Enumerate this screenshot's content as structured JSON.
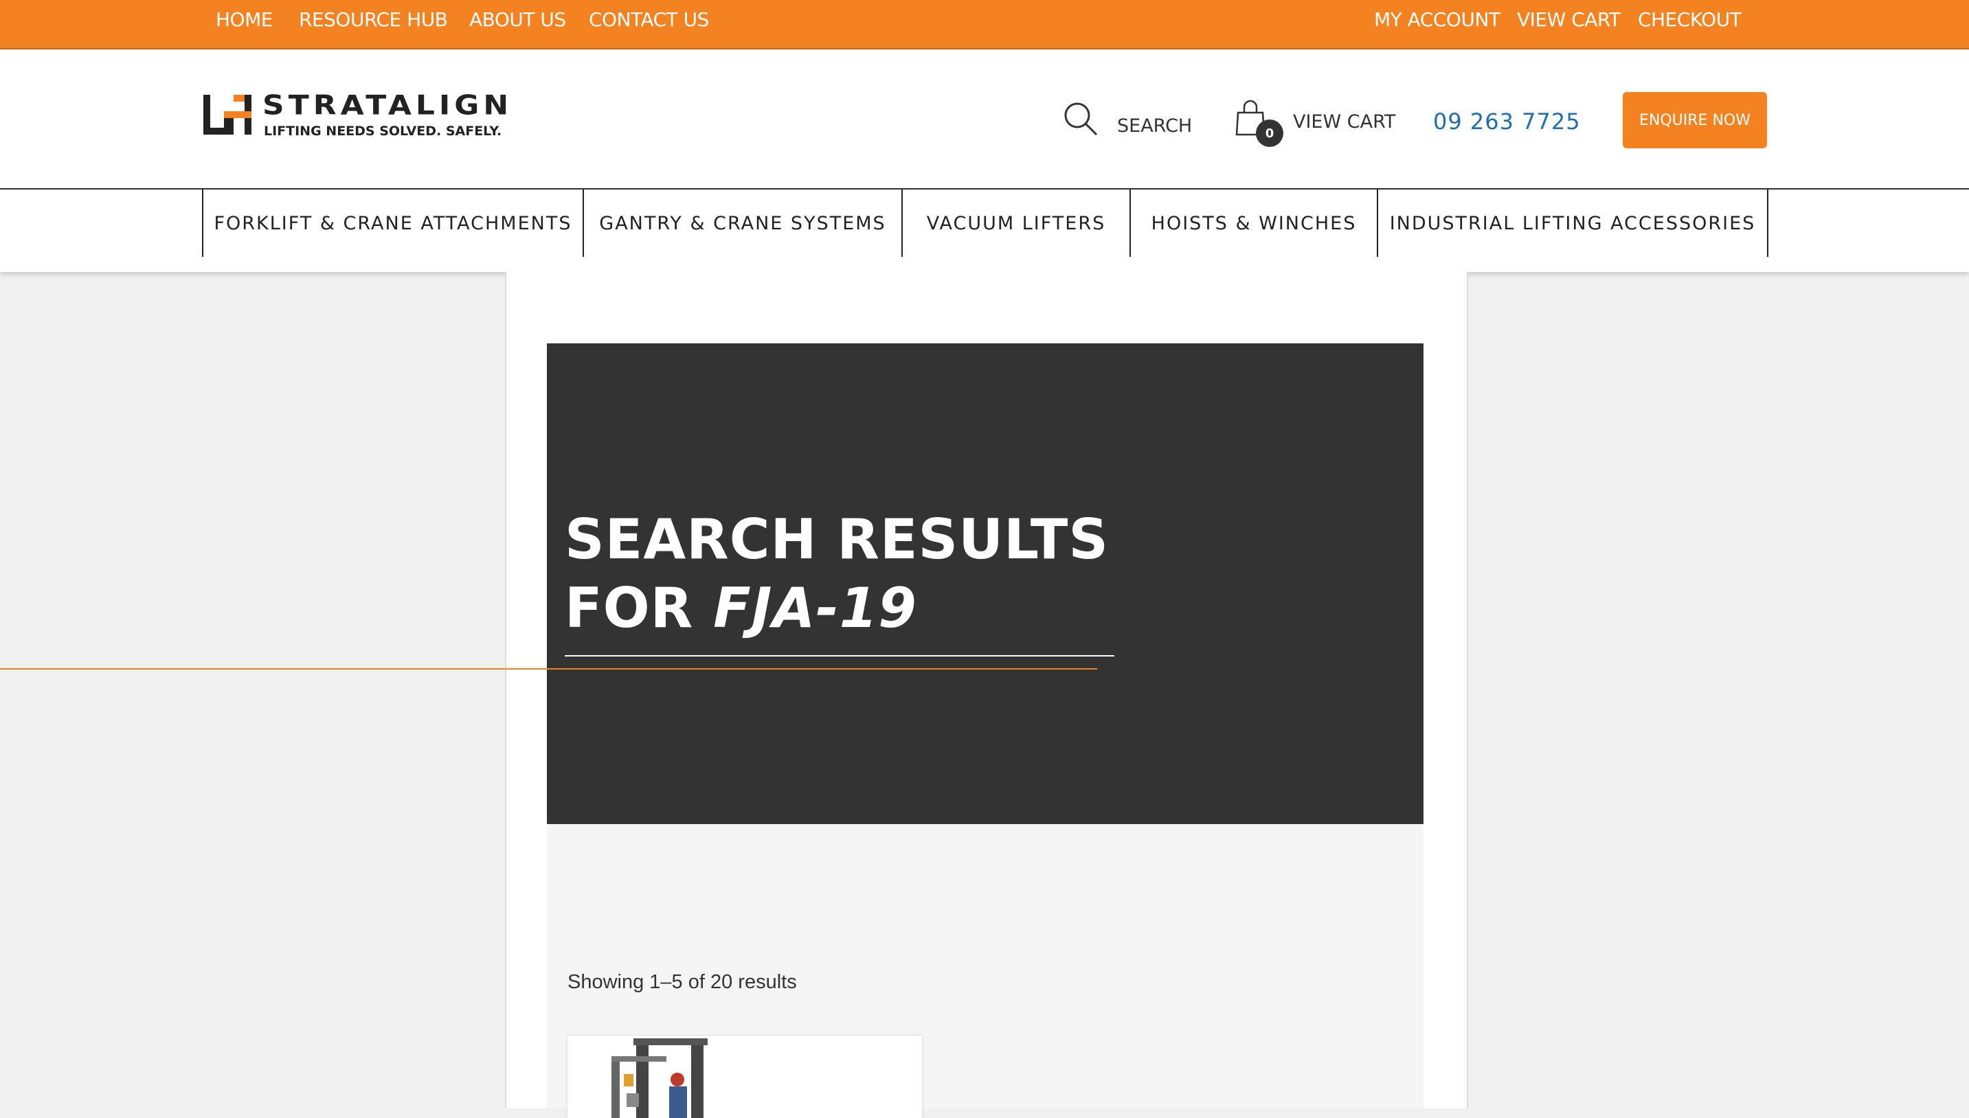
{
  "topbar": {
    "left_links": [
      "HOME",
      "RESOURCE HUB",
      "ABOUT US",
      "CONTACT US"
    ],
    "right_links": [
      "MY ACCOUNT",
      "VIEW CART",
      "CHECKOUT"
    ]
  },
  "header": {
    "logo_name": "STRATALIGN",
    "logo_tagline": "LIFTING NEEDS SOLVED. SAFELY.",
    "search_label": "SEARCH",
    "cart_label": "VIEW CART",
    "cart_count": "0",
    "phone": "09 263 7725",
    "enquire_label": "ENQUIRE NOW"
  },
  "categories": [
    "FORKLIFT & CRANE ATTACHMENTS",
    "GANTRY & CRANE SYSTEMS",
    "VACUUM LIFTERS",
    "HOISTS & WINCHES",
    "INDUSTRIAL LIFTING ACCESSORIES"
  ],
  "hero": {
    "title_line1": "SEARCH RESULTS",
    "title_prefix": "FOR ",
    "query": "FJA-19"
  },
  "results": {
    "count_text": "Showing 1–5 of 20 results"
  },
  "colors": {
    "accent": "#f58220",
    "hero_bg": "#333333",
    "phone": "#1f6fae"
  }
}
